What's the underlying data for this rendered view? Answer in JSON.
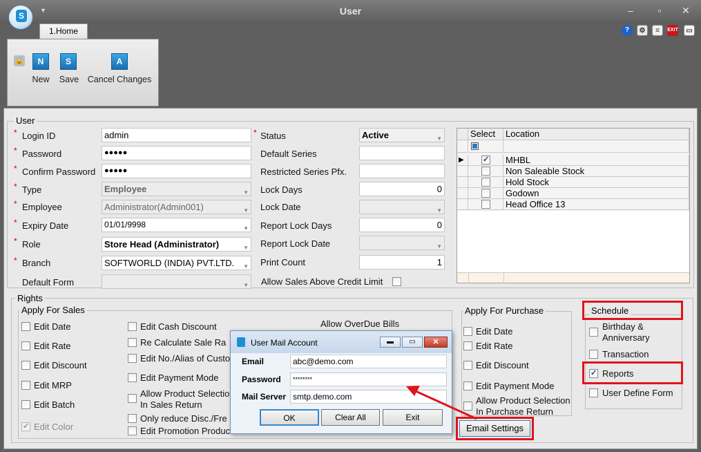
{
  "window": {
    "title": "User"
  },
  "tabs": [
    {
      "label": "1.Home"
    }
  ],
  "toolbar": {
    "new_label": "New",
    "save_label": "Save",
    "cancel_label": "Cancel Changes"
  },
  "user_group": {
    "title": "User"
  },
  "fields_left": {
    "login_id_label": "Login ID",
    "login_id_value": "admin",
    "password_label": "Password",
    "password_value": "●●●●●",
    "confirm_password_label": "Confirm Password",
    "confirm_password_value": "●●●●●",
    "type_label": "Type",
    "type_value": "Employee",
    "employee_label": "Employee",
    "employee_value": "Administrator(Admin001)",
    "expiry_label": "Expiry Date",
    "expiry_value": "01/01/9998",
    "role_label": "Role",
    "role_value": "Store Head (Administrator)",
    "branch_label": "Branch",
    "branch_value": "SOFTWORLD (INDIA) PVT.LTD.",
    "default_form_label": "Default Form",
    "default_form_value": ""
  },
  "fields_mid": {
    "status_label": "Status",
    "status_value": "Active",
    "default_series_label": "Default Series",
    "restricted_series_label": "Restricted Series Pfx.",
    "lock_days_label": "Lock Days",
    "lock_days_value": "0",
    "lock_date_label": "Lock Date",
    "report_lock_days_label": "Report Lock Days",
    "report_lock_days_value": "0",
    "report_lock_date_label": "Report Lock Date",
    "print_count_label": "Print Count",
    "print_count_value": "1",
    "allow_sales_label": "Allow Sales Above Credit Limit"
  },
  "location_grid": {
    "headers": [
      "Select",
      "Location"
    ],
    "rows": [
      {
        "location": "MHBL",
        "checked": true
      },
      {
        "location": "Non Saleable Stock",
        "checked": false
      },
      {
        "location": "Hold Stock",
        "checked": false
      },
      {
        "location": "Godown",
        "checked": false
      },
      {
        "location": "Head Office 13",
        "checked": false
      }
    ]
  },
  "rights": {
    "title": "Rights",
    "sales_title": "Apply For Sales",
    "sales_col1": [
      "Edit Date",
      "Edit Rate",
      "Edit Discount",
      "Edit MRP",
      "Edit Batch",
      "Edit Color"
    ],
    "sales_col2": [
      "Edit Cash Discount",
      "Re Calculate Sale Ra",
      "Edit No./Alias of Custo",
      "Edit Payment Mode",
      "Allow Product Selectio",
      "In Sales Return",
      "Only reduce Disc./Fre",
      "Edit Promotion Produc"
    ],
    "overdue_label": "Allow OverDue Bills",
    "purchase_title": "Apply For Purchase",
    "purchase_items": [
      "Edit Date",
      "Edit Rate",
      "Edit Discount",
      "Edit Payment Mode",
      "Allow Product Selection",
      "In Purchase Return"
    ],
    "email_settings_label": "Email Settings",
    "schedule_title": "Schedule",
    "schedule_items": [
      "Birthday &",
      "Anniversary",
      "Transaction",
      "Reports",
      "User Define Form"
    ]
  },
  "dialog": {
    "title": "User Mail Account",
    "email_label": "Email",
    "email_value": "abc@demo.com",
    "password_label": "Password",
    "password_value": "********",
    "server_label": "Mail Server",
    "server_value": "smtp.demo.com",
    "ok_label": "OK",
    "clear_label": "Clear All",
    "exit_label": "Exit"
  },
  "colors": {
    "highlight": "#e0141c",
    "accent": "#1e8fd6"
  }
}
